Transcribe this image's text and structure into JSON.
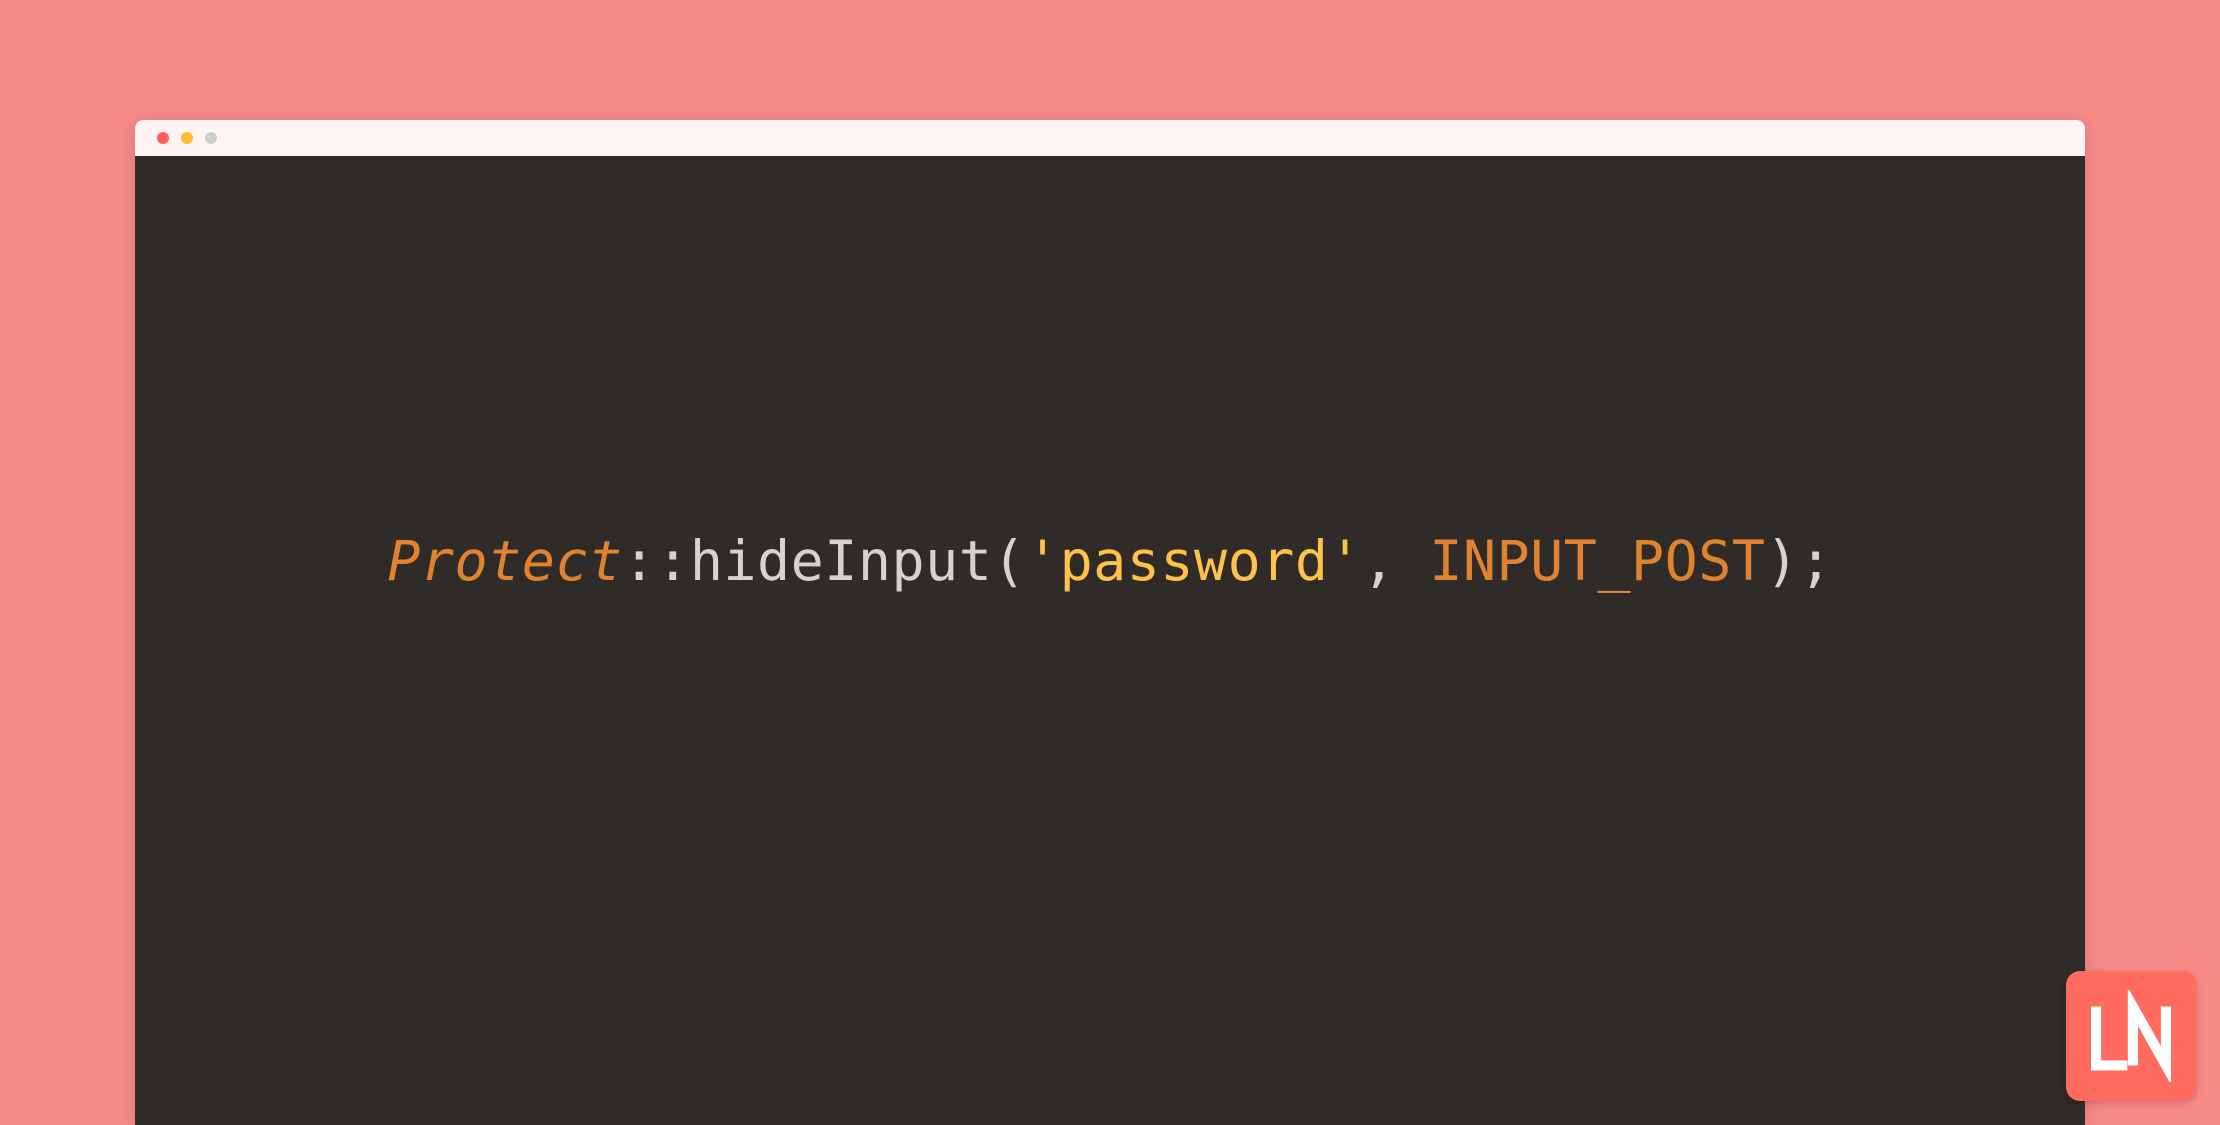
{
  "code": {
    "class": "Protect",
    "scope": "::",
    "method": "hideInput",
    "open_paren": "(",
    "string_arg": "'password'",
    "comma": ", ",
    "const_arg": "INPUT_POST",
    "close": ");"
  },
  "logo": {
    "text": "LN"
  },
  "colors": {
    "background": "#f98a8a",
    "editor_bg": "#2e2b29",
    "titlebar_bg": "#fef5f3",
    "class_color": "#e08330",
    "string_color": "#ffc14a",
    "punct_color": "#d6d3cf",
    "logo_bg": "#ff6b5f"
  }
}
